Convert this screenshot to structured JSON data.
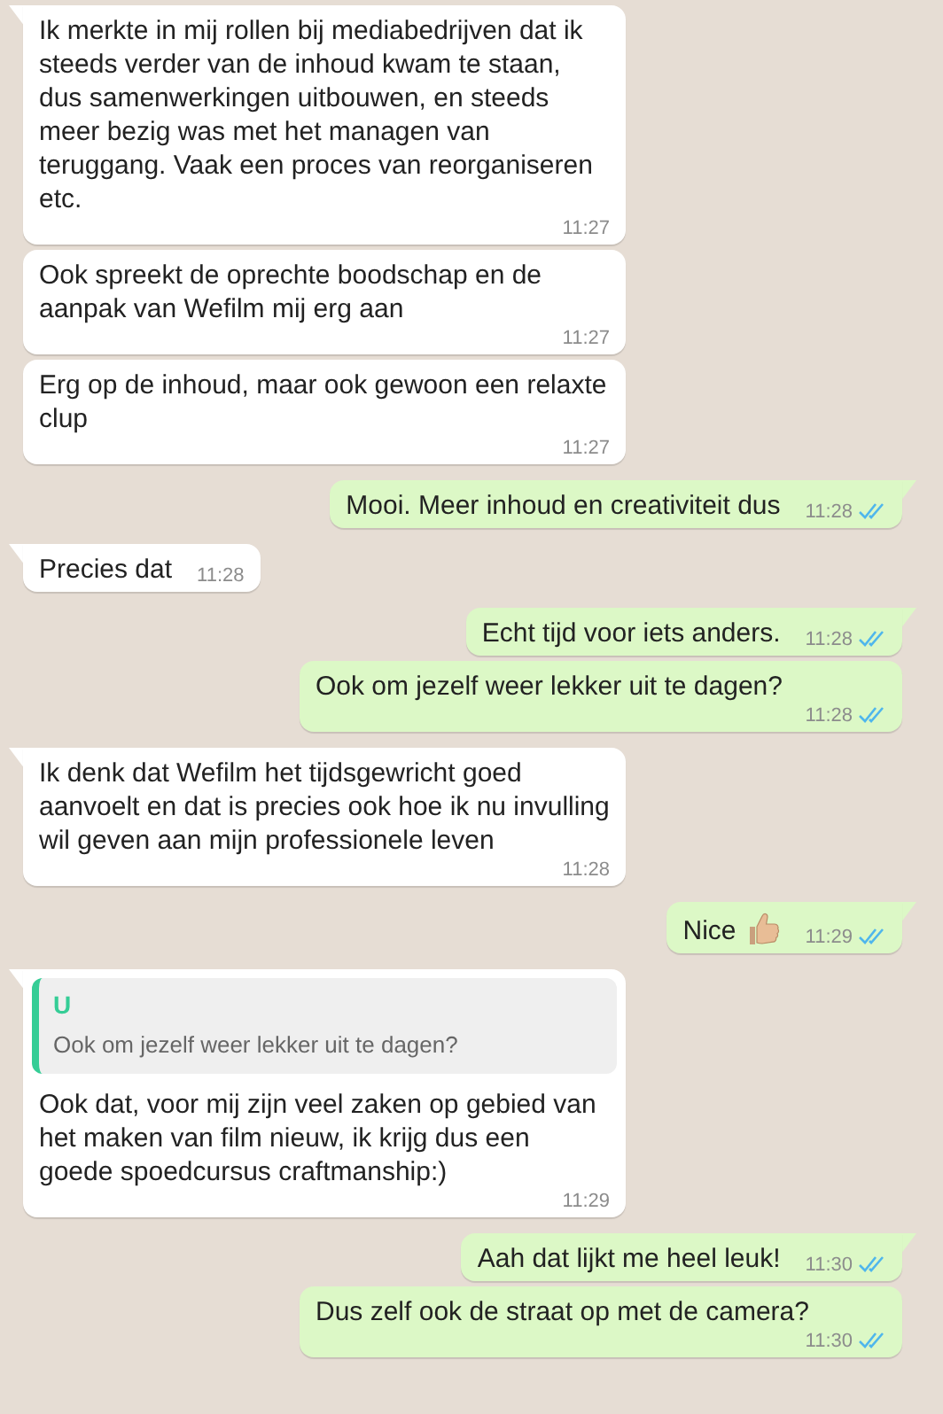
{
  "messages": [
    {
      "kind": "in",
      "tail": true,
      "text": "Ik merkte in mij rollen bij mediabedrijven dat ik steeds verder van de inhoud kwam te staan, dus samenwerkingen uitbouwen, en steeds meer bezig was met het managen van teruggang. Vaak een proces van reorganiseren etc.",
      "time": "11:27"
    },
    {
      "kind": "in",
      "tail": false,
      "text": "Ook spreekt de oprechte boodschap en de aanpak van Wefilm mij erg aan",
      "time": "11:27"
    },
    {
      "kind": "in",
      "tail": false,
      "text": "Erg op de inhoud, maar ook gewoon een relaxte clup",
      "time": "11:27"
    },
    {
      "kind": "out",
      "tail": true,
      "text": "Mooi. Meer inhoud en creativiteit dus",
      "time": "11:28",
      "read": true
    },
    {
      "kind": "in",
      "tail": true,
      "text": "Precies dat",
      "time": "11:28"
    },
    {
      "kind": "out",
      "tail": true,
      "text": "Echt tijd voor iets anders.",
      "time": "11:28",
      "read": true
    },
    {
      "kind": "out",
      "tail": false,
      "text": "Ook om jezelf weer lekker uit te dagen?",
      "time": "11:28",
      "read": true
    },
    {
      "kind": "in",
      "tail": true,
      "text": "Ik denk dat Wefilm het tijdsgewricht goed aanvoelt en dat is precies ook hoe ik nu invulling wil geven aan mijn professionele leven",
      "time": "11:28"
    },
    {
      "kind": "out",
      "tail": true,
      "text": "Nice",
      "time": "11:29",
      "read": true
    },
    {
      "kind": "in",
      "tail": true,
      "quote": {
        "author": "U",
        "text": "Ook om jezelf weer lekker uit te dagen?"
      },
      "text": "Ook dat, voor mij zijn veel zaken op gebied van het maken van film nieuw, ik krijg dus een goede spoedcursus craftmanship:)",
      "time": "11:29"
    },
    {
      "kind": "out",
      "tail": true,
      "text": "Aah dat lijkt me heel leuk!",
      "time": "11:30",
      "read": true
    },
    {
      "kind": "out",
      "tail": false,
      "text": "Dus zelf ook de straat op met de camera?",
      "time": "11:30",
      "read": true
    }
  ]
}
